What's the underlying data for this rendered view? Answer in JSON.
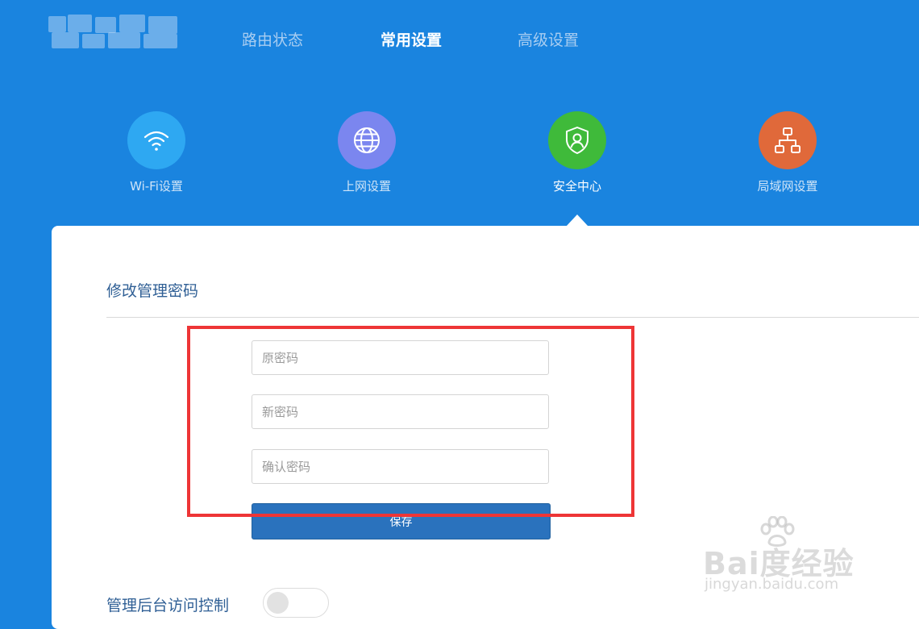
{
  "header": {
    "tabs": [
      {
        "label": "路由状态",
        "active": false
      },
      {
        "label": "常用设置",
        "active": true
      },
      {
        "label": "高级设置",
        "active": false
      }
    ]
  },
  "categories": [
    {
      "label": "Wi-Fi设置",
      "icon": "wifi-icon",
      "color": "#2ea8f2",
      "active": false
    },
    {
      "label": "上网设置",
      "icon": "globe-icon",
      "color": "#7b86ef",
      "active": false
    },
    {
      "label": "安全中心",
      "icon": "shield-user-icon",
      "color": "#3fba3a",
      "active": true
    },
    {
      "label": "局域网设置",
      "icon": "lan-topology-icon",
      "color": "#e0693a",
      "active": false
    }
  ],
  "password_section": {
    "title": "修改管理密码",
    "old_password": {
      "placeholder": "原密码",
      "value": ""
    },
    "new_password": {
      "placeholder": "新密码",
      "value": ""
    },
    "confirm_password": {
      "placeholder": "确认密码",
      "value": ""
    },
    "save_label": "保存"
  },
  "access_control": {
    "label": "管理后台访问控制",
    "enabled": false
  },
  "watermark": {
    "brand": "Bai度经验",
    "url": "jingyan.baidu.com"
  },
  "colors": {
    "header_bg": "#1a84df",
    "highlight": "#ee3536",
    "save_button": "#2a72bd"
  }
}
